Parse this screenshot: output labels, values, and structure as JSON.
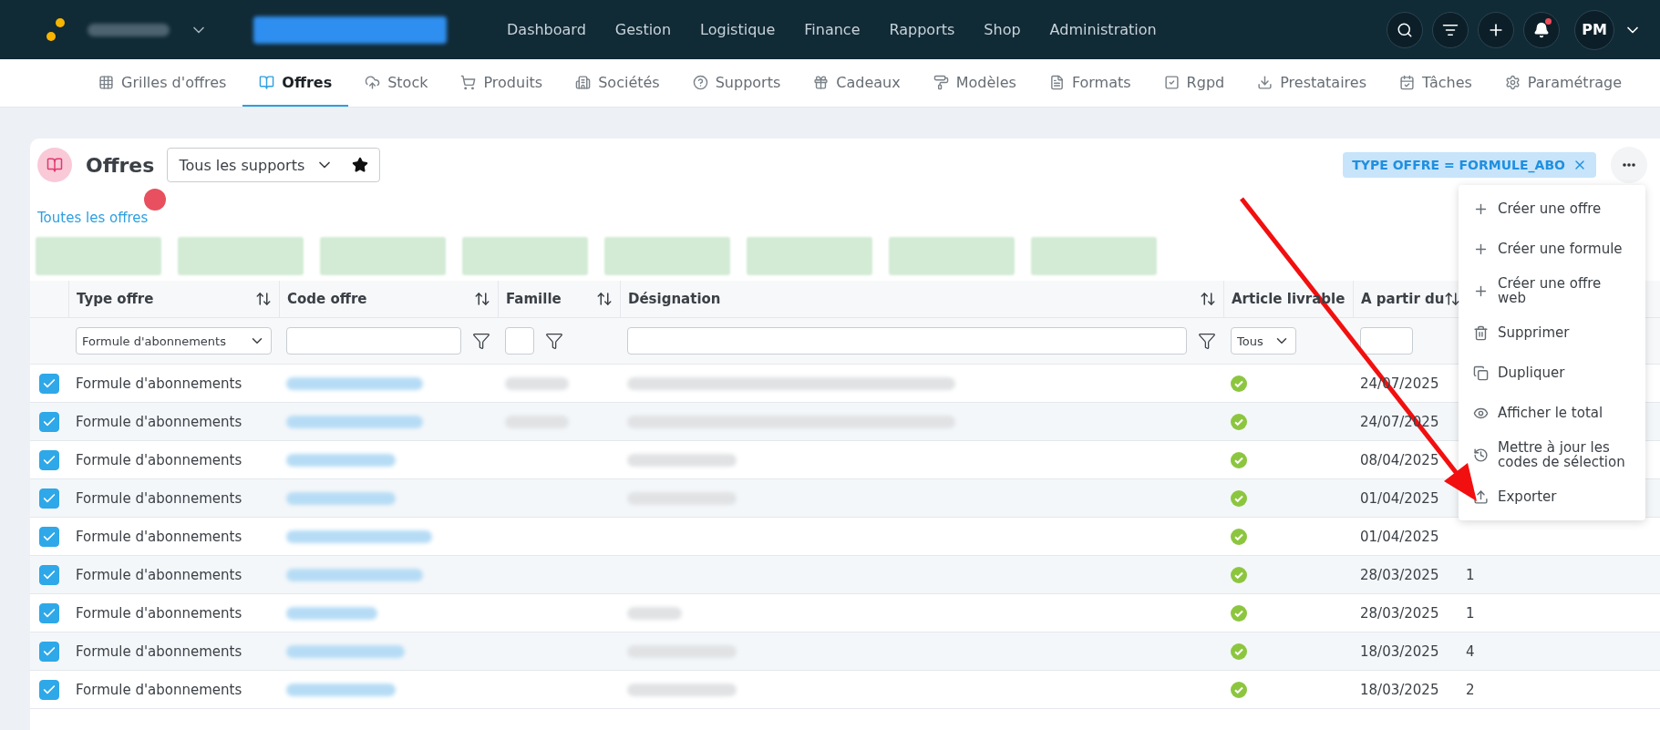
{
  "topbar": {
    "nav": [
      {
        "label": "Dashboard"
      },
      {
        "label": "Gestion"
      },
      {
        "label": "Logistique"
      },
      {
        "label": "Finance"
      },
      {
        "label": "Rapports"
      },
      {
        "label": "Shop"
      },
      {
        "label": "Administration"
      }
    ],
    "avatar": "PM",
    "bell_unread": true
  },
  "subnav": [
    {
      "label": "Grilles d'offres",
      "selected": false
    },
    {
      "label": "Offres",
      "selected": true
    },
    {
      "label": "Stock",
      "selected": false
    },
    {
      "label": "Produits",
      "selected": false
    },
    {
      "label": "Sociétés",
      "selected": false
    },
    {
      "label": "Supports",
      "selected": false
    },
    {
      "label": "Cadeaux",
      "selected": false
    },
    {
      "label": "Modèles",
      "selected": false
    },
    {
      "label": "Formats",
      "selected": false
    },
    {
      "label": "Rgpd",
      "selected": false
    },
    {
      "label": "Prestataires",
      "selected": false
    },
    {
      "label": "Tâches",
      "selected": false
    },
    {
      "label": "Paramétrage",
      "selected": false
    }
  ],
  "page": {
    "title": "Offres",
    "support_select": "Tous les supports",
    "view_tab": {
      "label": "Toutes les offres",
      "selected": true
    },
    "filter_tag": "TYPE OFFRE = FORMULE_ABO"
  },
  "table": {
    "columns": [
      {
        "label": "Type offre",
        "sortable": true
      },
      {
        "label": "Code offre",
        "sortable": true
      },
      {
        "label": "Famille",
        "sortable": true
      },
      {
        "label": "Désignation",
        "sortable": true
      },
      {
        "label": "Article livrable",
        "sortable": false
      },
      {
        "label": "A partir du",
        "sortable": true
      }
    ],
    "filters": [
      {
        "kind": "select",
        "value": "Formule d'abonnements"
      },
      {
        "kind": "text",
        "funnel": true
      },
      {
        "kind": "small",
        "funnel": true
      },
      {
        "kind": "text",
        "funnel": true
      },
      {
        "kind": "select",
        "value": "Tous"
      },
      {
        "kind": "short"
      }
    ],
    "rows": [
      {
        "selected": true,
        "type_offre": "Formule d'abonnements",
        "livrable": true,
        "date": "24/07/2025"
      },
      {
        "selected": true,
        "type_offre": "Formule d'abonnements",
        "livrable": true,
        "date": "24/07/2025"
      },
      {
        "selected": true,
        "type_offre": "Formule d'abonnements",
        "livrable": true,
        "date": "08/04/2025"
      },
      {
        "selected": true,
        "type_offre": "Formule d'abonnements",
        "livrable": true,
        "date": "01/04/2025"
      },
      {
        "selected": true,
        "type_offre": "Formule d'abonnements",
        "livrable": true,
        "date": "01/04/2025"
      },
      {
        "selected": true,
        "type_offre": "Formule d'abonnements",
        "livrable": true,
        "date": "28/03/2025",
        "column_8": "1"
      },
      {
        "selected": true,
        "type_offre": "Formule d'abonnements",
        "livrable": true,
        "date": "28/03/2025",
        "column_8": "1"
      },
      {
        "selected": true,
        "type_offre": "Formule d'abonnements",
        "livrable": true,
        "date": "18/03/2025",
        "column_8": "4"
      },
      {
        "selected": true,
        "type_offre": "Formule d'abonnements",
        "livrable": true,
        "date": "18/03/2025",
        "column_8": "2"
      }
    ]
  },
  "menu": {
    "items": [
      {
        "label": "Créer une offre"
      },
      {
        "label": "Créer une formule"
      },
      {
        "label": "Créer une offre web"
      },
      {
        "label": "Supprimer"
      },
      {
        "label": "Dupliquer"
      },
      {
        "label": "Afficher le total"
      },
      {
        "label": "Mettre à jour les codes de sélection"
      },
      {
        "label": "Exporter"
      }
    ]
  }
}
